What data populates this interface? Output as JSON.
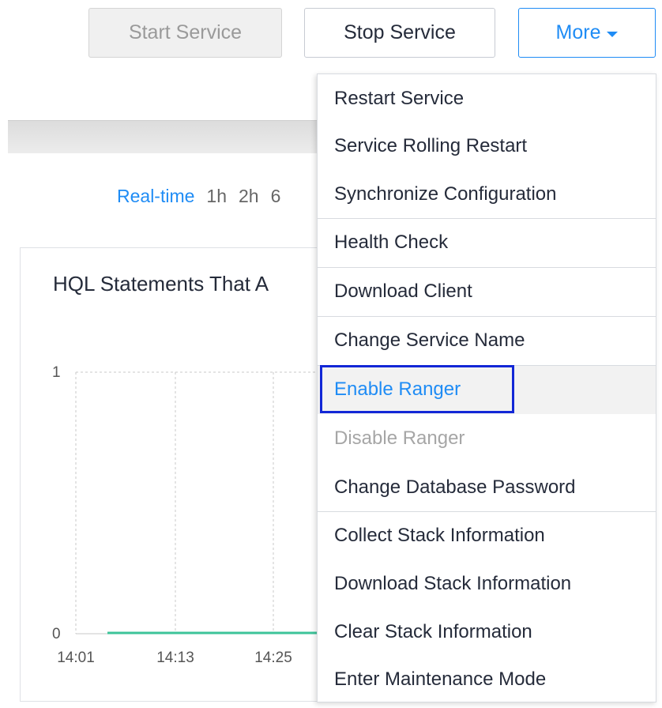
{
  "toolbar": {
    "start_label": "Start Service",
    "stop_label": "Stop Service",
    "more_label": "More"
  },
  "time_range": {
    "items": [
      "Real-time",
      "1h",
      "2h",
      "6"
    ],
    "active": "Real-time"
  },
  "panel": {
    "title": "HQL Statements That A"
  },
  "chart_data": {
    "type": "line",
    "title": "HQL Statements That A",
    "x": [
      "14:01",
      "14:13",
      "14:25"
    ],
    "ylim": [
      0,
      1
    ],
    "yticks": [
      "1",
      "0"
    ],
    "series": [
      {
        "values": [
          0,
          0,
          0
        ],
        "color": "#3cc399"
      }
    ],
    "grid": true
  },
  "menu": {
    "items": [
      {
        "label": "Restart Service",
        "state": "normal"
      },
      {
        "label": "Service Rolling Restart",
        "state": "normal"
      },
      {
        "label": "Synchronize Configuration",
        "state": "normal"
      },
      {
        "label": "Health Check",
        "state": "normal"
      },
      {
        "label": "Download Client",
        "state": "normal"
      },
      {
        "label": "Change Service Name",
        "state": "normal"
      },
      {
        "label": "Enable Ranger",
        "state": "highlighted"
      },
      {
        "label": "Disable Ranger",
        "state": "disabled"
      },
      {
        "label": "Change Database Password",
        "state": "normal"
      },
      {
        "label": "Collect Stack Information",
        "state": "normal"
      },
      {
        "label": "Download Stack Information",
        "state": "normal"
      },
      {
        "label": "Clear Stack Information",
        "state": "normal"
      },
      {
        "label": "Enter Maintenance Mode",
        "state": "normal"
      }
    ]
  },
  "colors": {
    "accent": "#1f8cf5",
    "focus": "#1227d6",
    "series_line": "#3cc399"
  }
}
